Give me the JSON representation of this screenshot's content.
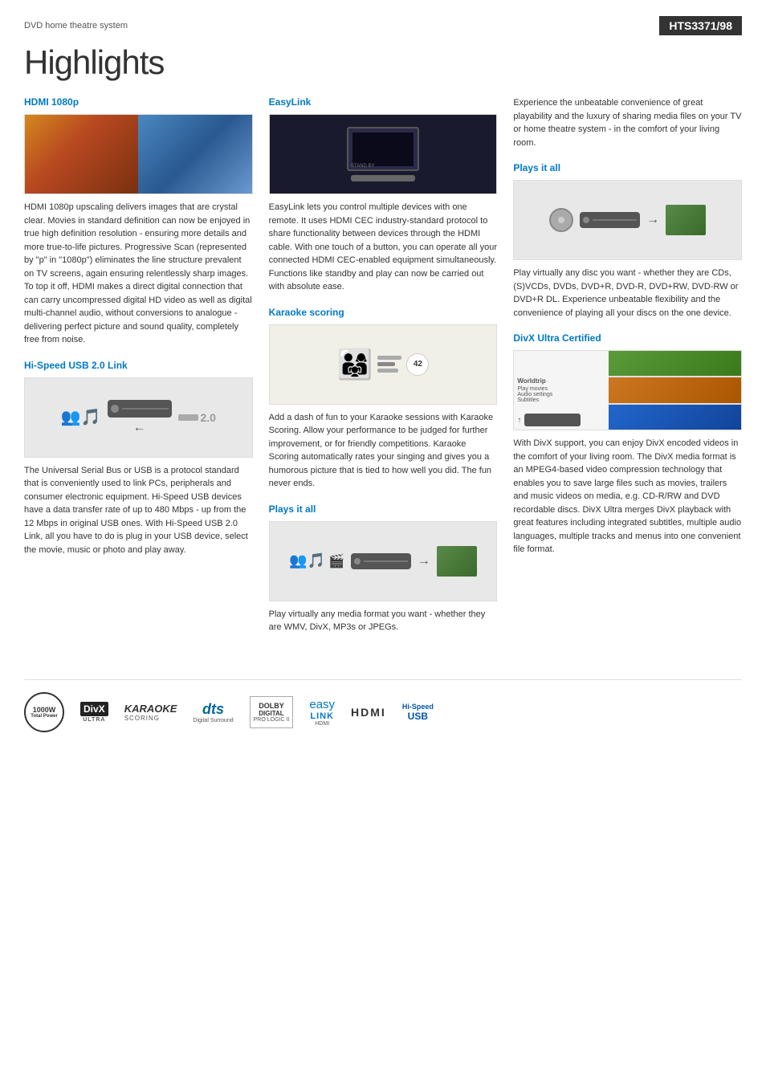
{
  "header": {
    "category": "DVD home theatre system",
    "model": "HTS3371/98",
    "title": "Highlights"
  },
  "features": {
    "hdmi": {
      "title": "HDMI 1080p",
      "text": "HDMI 1080p upscaling delivers images that are crystal clear. Movies in standard definition can now be enjoyed in true high definition resolution - ensuring more details and more true-to-life pictures. Progressive Scan (represented by \"p\" in \"1080p\") eliminates the line structure prevalent on TV screens, again ensuring relentlessly sharp images. To top it off, HDMI makes a direct digital connection that can carry uncompressed digital HD video as well as digital multi-channel audio, without conversions to analogue - delivering perfect picture and sound quality, completely free from noise."
    },
    "usb": {
      "title": "Hi-Speed USB 2.0 Link",
      "text": "The Universal Serial Bus or USB is a protocol standard that is conveniently used to link PCs, peripherals and consumer electronic equipment. Hi-Speed USB devices have a data transfer rate of up to 480 Mbps - up from the 12 Mbps in original USB ones. With Hi-Speed USB 2.0 Link, all you have to do is plug in your USB device, select the movie, music or photo and play away."
    },
    "easylink": {
      "title": "EasyLink",
      "text": "EasyLink lets you control multiple devices with one remote. It uses HDMI CEC industry-standard protocol to share functionality between devices through the HDMI cable. With one touch of a button, you can operate all your connected HDMI CEC-enabled equipment simultaneously. Functions like standby and play can now be carried out with absolute ease."
    },
    "karaoke": {
      "title": "Karaoke scoring",
      "text": "Add a dash of fun to your Karaoke sessions with Karaoke Scoring. Allow your performance to be judged for further improvement, or for friendly competitions. Karaoke Scoring automatically rates your singing and gives you a humorous picture that is tied to how well you did. The fun never ends."
    },
    "plays_it_all_2": {
      "title": "Plays it all",
      "text": "Play virtually any media format you want - whether they are WMV, DivX, MP3s or JPEGs."
    },
    "intro_right": {
      "text": "Experience the unbeatable convenience of great playability and the luxury of sharing media files on your TV or home theatre system - in the comfort of your living room."
    },
    "plays_it_all_1": {
      "title": "Plays it all",
      "text": "Play virtually any disc you want - whether they are CDs, (S)VCDs, DVDs, DVD+R, DVD-R, DVD+RW, DVD-RW or DVD+R DL. Experience unbeatable flexibility and the convenience of playing all your discs on the one device."
    },
    "divx": {
      "title": "DivX Ultra Certified",
      "text": "With DivX support, you can enjoy DivX encoded videos in the comfort of your living room. The DivX media format is an MPEG4-based video compression technology that enables you to save large files such as movies, trailers and music videos on media, e.g. CD-R/RW and DVD recordable discs. DivX Ultra merges DivX playback with great features including integrated subtitles, multiple audio languages, multiple tracks and menus into one convenient file format."
    }
  },
  "footer_logos": [
    {
      "id": "1000w",
      "label": "1000W\nTotal Power"
    },
    {
      "id": "divx-ultra",
      "label": "DivX ULTRA"
    },
    {
      "id": "karaoke-scoring",
      "label": "KARAOKE SCORING"
    },
    {
      "id": "dts",
      "label": "dts Digital Surround"
    },
    {
      "id": "dolby",
      "label": "DOLBY DIGITAL PRO LOGIC II"
    },
    {
      "id": "easylink",
      "label": "easy LINK HDMI"
    },
    {
      "id": "hdmi",
      "label": "HDMI"
    },
    {
      "id": "usb",
      "label": "Hi-Speed USB"
    }
  ]
}
